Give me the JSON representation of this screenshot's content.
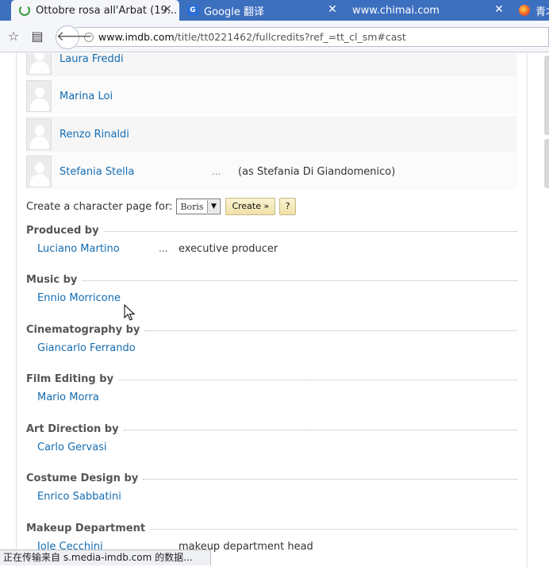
{
  "tabs": [
    {
      "title": "Ottobre rosa all'Arbat (19...",
      "icon": "loading-spinner-icon",
      "active": true
    },
    {
      "title": "Google 翻译",
      "icon": "google-translate-icon",
      "active": false
    },
    {
      "title": "www.chimai.com",
      "icon": "",
      "active": false
    },
    {
      "title": "青才",
      "icon": "colorful-site-icon",
      "active": false
    }
  ],
  "toolbar": {
    "url_domain": "www.imdb.com",
    "url_path": "/title/tt0221462/fullcredits?ref_=tt_cl_sm#cast"
  },
  "cast": [
    {
      "name": "Laura Freddi",
      "dots": "",
      "character": ""
    },
    {
      "name": "Marina Loi",
      "dots": "",
      "character": ""
    },
    {
      "name": "Renzo Rinaldi",
      "dots": "",
      "character": ""
    },
    {
      "name": "Stefania Stella",
      "dots": "...",
      "character": "(as Stefania Di Giandomenico)"
    }
  ],
  "character_page": {
    "label": "Create a character page for:",
    "selected": "Boris",
    "create_label": "Create »",
    "help_label": "?"
  },
  "sections": [
    {
      "title": "Produced by",
      "name": "Luciano Martino",
      "dots": "...",
      "role": "executive producer"
    },
    {
      "title": "Music by",
      "name": "Ennio Morricone",
      "dots": "",
      "role": ""
    },
    {
      "title": "Cinematography by",
      "name": "Giancarlo Ferrando",
      "dots": "",
      "role": ""
    },
    {
      "title": "Film Editing by",
      "name": "Mario Morra",
      "dots": "",
      "role": ""
    },
    {
      "title": "Art Direction by",
      "name": "Carlo Gervasi",
      "dots": "",
      "role": ""
    },
    {
      "title": "Costume Design by",
      "name": "Enrico Sabbatini",
      "dots": "",
      "role": ""
    },
    {
      "title": "Makeup Department",
      "name": "Iole Cecchini",
      "dots": "",
      "role": "makeup department head"
    }
  ],
  "status": "正在传输来自 s.media-imdb.com 的数据...",
  "colors": {
    "tabstrip": "#3d6fbf",
    "link": "#136cb2",
    "button": "#efe1a8"
  }
}
